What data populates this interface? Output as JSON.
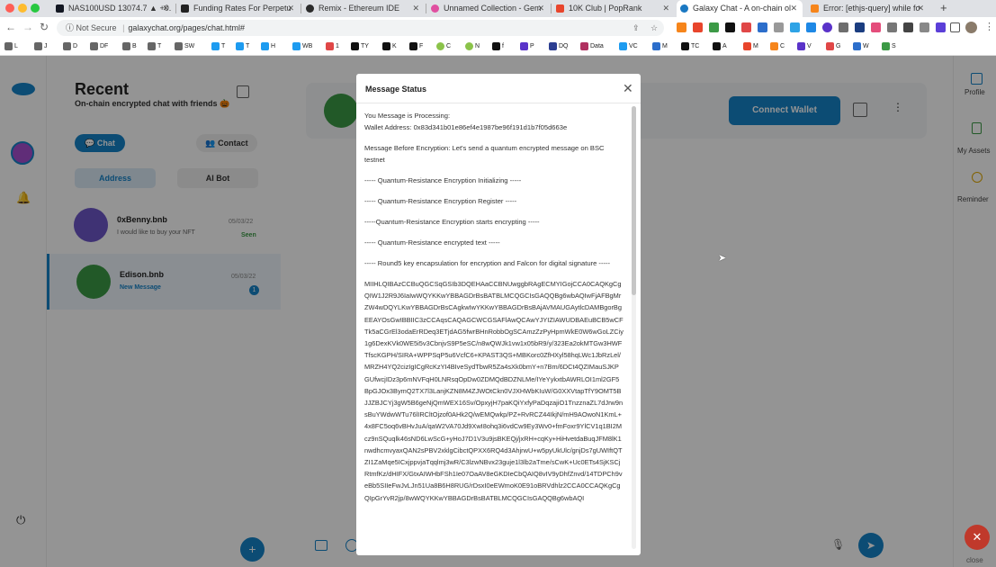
{
  "browser": {
    "tabs": [
      {
        "label": "NAS100USD 13074.7 ▲ +0.",
        "color": "#131722"
      },
      {
        "label": "Funding Rates For Perpetu",
        "color": "#222222"
      },
      {
        "label": "Remix - Ethereum IDE",
        "color": "#2b2b2b"
      },
      {
        "label": "Unnamed Collection - Gem",
        "color": "#e04fa0"
      },
      {
        "label": "10K Club | PopRank",
        "color": "#e8452c"
      },
      {
        "label": "Galaxy Chat - A on-chain ol",
        "color": "#1a78c2"
      },
      {
        "label": "Error: [ethjs-query] while fo",
        "color": "#f6851b"
      }
    ],
    "new_tab": "+",
    "address": {
      "security": "Not Secure",
      "separator": "|",
      "url": "galaxychat.org/pages/chat.html#"
    },
    "bookmarks": [
      "L",
      "J",
      "D",
      "DF",
      "B",
      "T",
      "SW",
      "T",
      "T",
      "H",
      "WB",
      "1",
      "TY",
      "K",
      "F",
      "C",
      "N",
      "f",
      "P",
      "DQ",
      "Data",
      "VC",
      "M",
      "TC",
      "A",
      "M",
      "C",
      "V",
      "G",
      "W",
      "S"
    ]
  },
  "app": {
    "header": {
      "title": "Recent",
      "subtitle": "On-chain encrypted chat with friends 🎃"
    },
    "buttons": {
      "chat": "Chat",
      "contact": "Contact",
      "connect_wallet": "Connect Wallet",
      "add": "+",
      "send": "➤"
    },
    "tabs": {
      "address": "Address",
      "ai_bot": "AI Bot"
    },
    "chats": [
      {
        "name": "0xBenny.bnb",
        "preview": "I would like to buy your NFT",
        "date": "05/03/22",
        "status": "Seen"
      },
      {
        "name": "Edison.bnb",
        "preview": "New Message",
        "date": "05/03/22",
        "unread": "1"
      }
    ],
    "right_rail": {
      "profile": "Profile",
      "assets": "My Assets",
      "reminder": "Reminder",
      "close": "close"
    }
  },
  "modal": {
    "title": "Message Status",
    "lines": [
      "You Message is Processing:",
      "Wallet Address: 0x83d341b01e86ef4e1987be96f191d1b7f05d663e",
      "Message Before Encryption: Let's send a quantum encrypted message on BSC testnet",
      "----- Quantum-Resistance Encryption Initializing -----",
      "----- Quantum-Resistance Encryption Register -----",
      "-----Quantum-Resistance Encryption starts encrypting -----",
      "----- Quantum-Resistance encrypted text -----",
      "----- Round5 key encapsulation for encryption and Falcon for digital signature -----"
    ],
    "ciphertext": "MIIHLQIBAzCCBuQGCSqGSIb3DQEHAaCCBNUwggbRAgECMYIGojCCA0CAQKgCgQIW1J2R9J6IaIwWQYKKwYBBAGDrBsBATBLMCQGCIsGAQQBg6wbAQIwFjAFBgMrZW4wDQYLKwYBBAGDrBsCAgkwIwYKKwYBBAGDrBsBAjAVMAUGAytlcDAMBgorBgEEAYOsGwIBBIIC3zCCAqsCAQAGCWCGSAFlAwQCAwYJYIZIAWUDBAEuBCB5wCFTk5aCGrEl3odaErRDeq3ETjdAG5fwrBHnRobbOgSCAmzZzPyHpmWkE0W6wGoLZCiy1g6DexKVk0WE5i5v3CbnjvS9P5eSC/n8wQWJk1vw1x05bR9/y/323Ea2okMTGw3HWFTfscKGPH/SIRA+WPPSqP5u6VcfC6+KPAST3QS+MBKorc0ZfHXyl58hqLWc1JbRzLel/MRZH4YQ2cizIgICgRcKzYI4BIveSydTbwR5Za4sXk0bmY+n7Bm/6DCt4QZIMauSJKPGUfwcjIDz3p6mNVFqH0LNRsqOpDw0ZDMQdBDZNLMe/IYeYykxtbAWRLOI1ml2GF5BpGJOx3BymQ2TX7l3LanjKZN8M4ZJWOtCkn0VJXHWbKIuW/G0XXVtapTfY9OMT5BJJZBJCYj3gW5B6geNjQmWEX16Sv/OpxyjH7paKQiYxfyPaDqzajiO1TnzznaZL7dJrw9nsBuYWdwWTu76lIRCltOjzof0AHk2Q/wEMQwkp/PZ+RvRCZ44IkjN/mH9AOwoN1KmL+4x8FC5oq6vBHvJuA/qaW2VA70Jd9XwI8ohq3i6vdCw9Ey3Wv0+fmFoxr9YlCV1q1BI2Mcz9nSQuqlk46sND6LwScG+yHoJ7D1V3u9jsBKEQj/jxRH+cqKy+HiHvetdaBuqJFM8lK1nwdhcmvyaxQAN2sPBV2xklgCibctQPXX6RQ4d3AhjrwU+w5pyUkUlc/gnjDs7gUWIftQTZI1ZaMqe5ICxjppvjaTqqlmj3wR/C3lzwNBvx23guje1l3lb2aTme/sCwK+Uc0ETs4SjKSCjRtmfKz/dHIFX/GtxAIWHbFSh1Ie07OaAV8eGKDIeCbQAIQ8vIV9yDhfZnvd/14TDPCh9veBb5SIIeFwJvLJn51Ua8B6H8RUG/rDsxI0eEWmoK0E91oBRVdhlz2CCA0CCAQKgCgQIpGrYvR2jp/8wWQYKKwYBBAGDrBsBATBLMCQGCIsGAQQBg6wbAQI"
  }
}
